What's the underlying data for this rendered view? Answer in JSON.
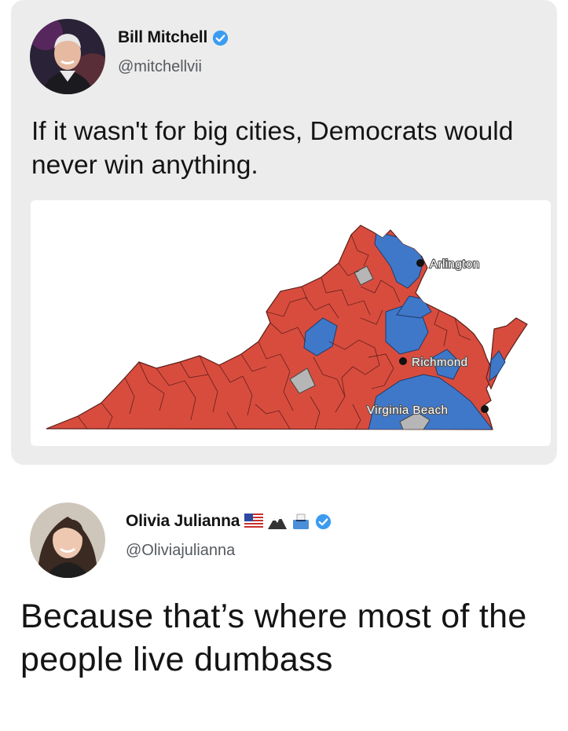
{
  "colors": {
    "republican": "#d84c3e",
    "democrat": "#3f78c9",
    "tie": "#b6b6b6",
    "verified": "#3b9cf0"
  },
  "tweet1": {
    "author_name": "Bill Mitchell",
    "author_handle": "@mitchellvii",
    "text": "If it wasn't for big cities, Democrats would never win anything.",
    "map": {
      "city_labels": [
        "Arlington",
        "Richmond",
        "Virginia Beach"
      ]
    }
  },
  "tweet2": {
    "author_name": "Olivia Julianna",
    "author_handle": "@Oliviajulianna",
    "name_emojis": [
      "us-flag-icon",
      "mountain-icon",
      "ballot-box-icon"
    ],
    "text": "Because that’s where most of the people live dumbass"
  }
}
